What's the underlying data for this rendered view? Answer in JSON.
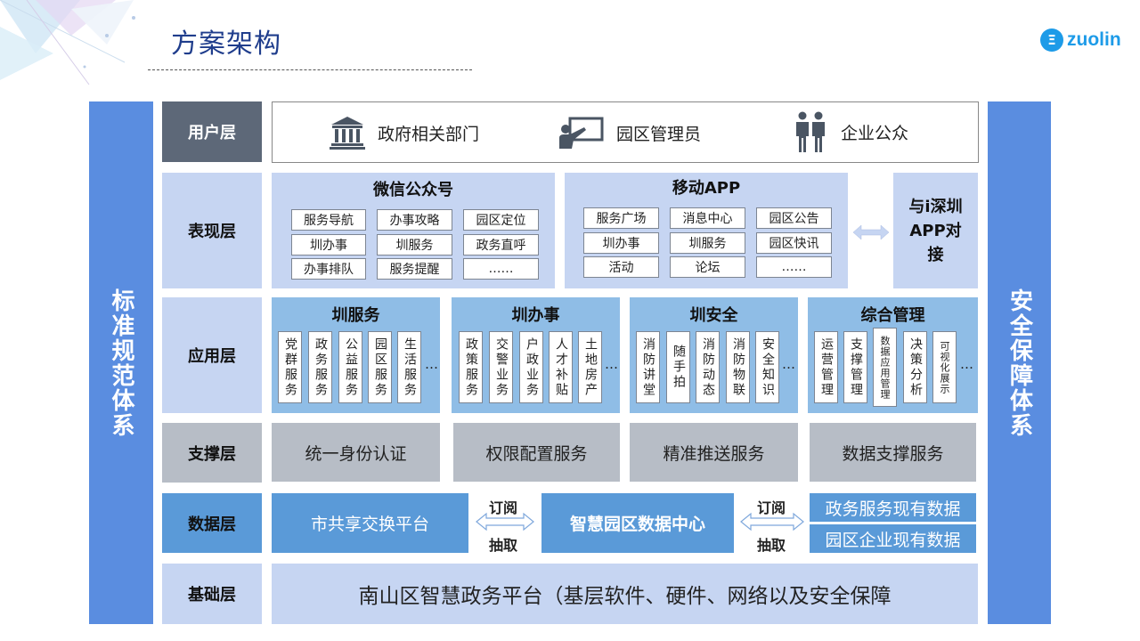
{
  "header": {
    "title": "方案架构",
    "logo_mark": "Ξ",
    "logo_text": "zuolin"
  },
  "side_left": "标准规范体系",
  "side_right": "安全保障体系",
  "layers": {
    "user": "用户层",
    "presentation": "表现层",
    "application": "应用层",
    "support": "支撑层",
    "data": "数据层",
    "foundation": "基础层"
  },
  "users": [
    {
      "label": "政府相关部门",
      "icon": "government-building-icon"
    },
    {
      "label": "园区管理员",
      "icon": "presenter-icon"
    },
    {
      "label": "企业公众",
      "icon": "people-icon"
    }
  ],
  "presentation": {
    "wechat": {
      "title": "微信公众号",
      "items": [
        "服务导航",
        "办事攻略",
        "园区定位",
        "圳办事",
        "圳服务",
        "政务直呼",
        "办事排队",
        "服务提醒",
        "……"
      ]
    },
    "app": {
      "title": "移动APP",
      "items": [
        "服务广场",
        "消息中心",
        "园区公告",
        "圳办事",
        "圳服务",
        "园区快讯",
        "活动",
        "论坛",
        "……"
      ]
    },
    "link": "与i深圳APP对接"
  },
  "application": [
    {
      "title": "圳服务",
      "items": [
        "党群服务",
        "政务服务",
        "公益服务",
        "园区服务",
        "生活服务"
      ]
    },
    {
      "title": "圳办事",
      "items": [
        "政策服务",
        "交警业务",
        "户政业务",
        "人才补贴",
        "土地房产"
      ]
    },
    {
      "title": "圳安全",
      "items": [
        "消防讲堂",
        "随手拍",
        "消防动态",
        "消防物联",
        "安全知识"
      ]
    },
    {
      "title": "综合管理",
      "items": [
        "运营管理",
        "支撑管理",
        "数据应用管理",
        "决策分析",
        "可视化展示"
      ]
    }
  ],
  "ellipsis": "…",
  "support": [
    "统一身份认证",
    "权限配置服务",
    "精准推送服务",
    "数据支撑服务"
  ],
  "data_layer": {
    "left": "市共享交换平台",
    "center": "智慧园区数据中心",
    "right_top": "政务服务现有数据",
    "right_bottom": "园区企业现有数据",
    "arrow_top": "订阅",
    "arrow_bottom": "抽取"
  },
  "foundation": "南山区智慧政务平台（基层软件、硬件、网络以及安全保障",
  "colors": {
    "title": "#1f3d8c",
    "side_bar": "#5a8de0",
    "layer_dark": "#5d6878",
    "light_blue": "#c6d5f2",
    "mid_blue": "#8fbde6",
    "data_blue": "#5a9ad8",
    "gray": "#b7bdc6",
    "logo": "#1d9be8"
  }
}
